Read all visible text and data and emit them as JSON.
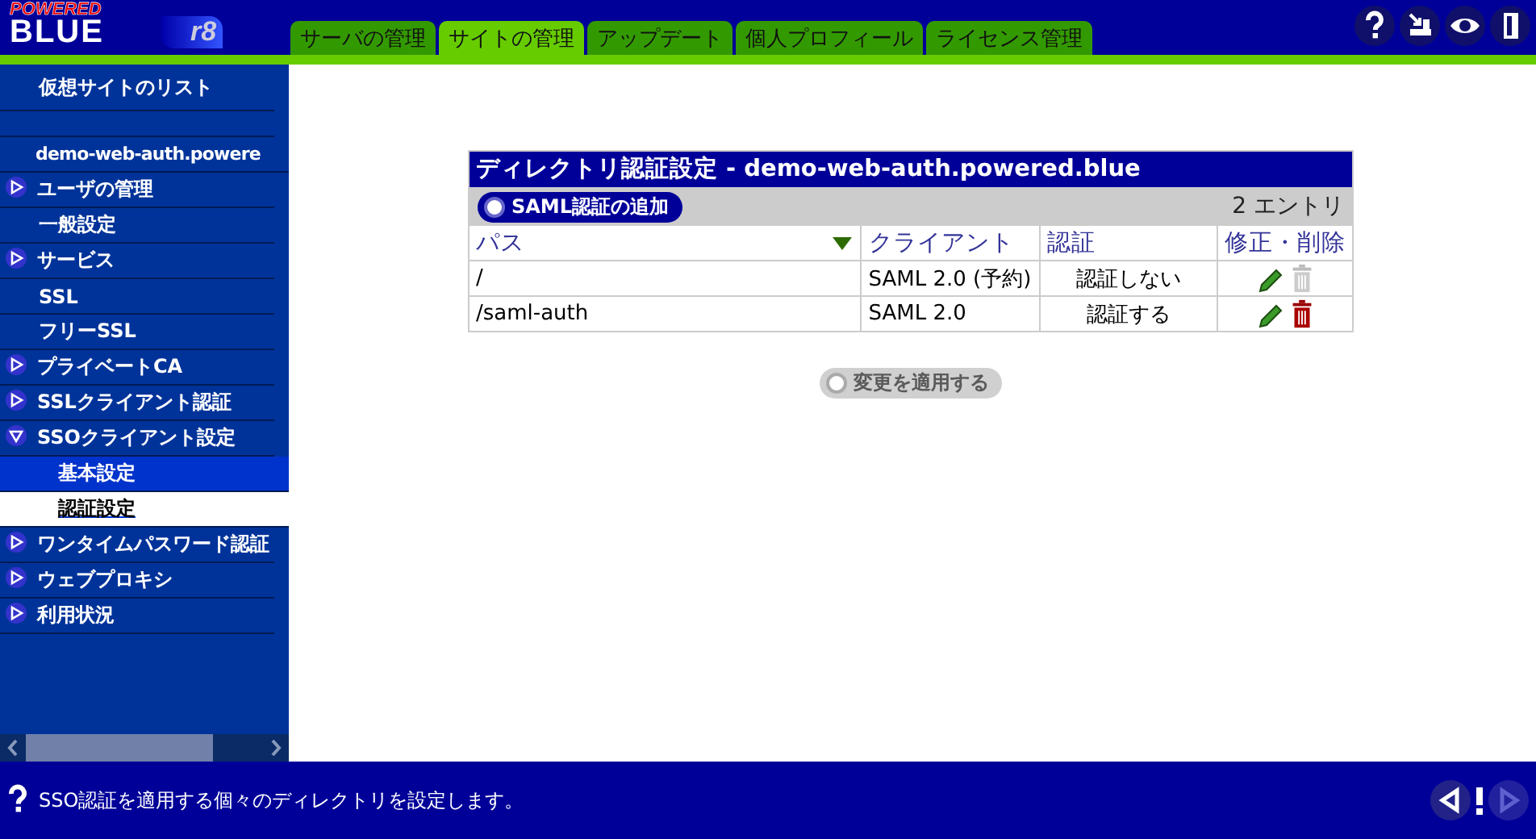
{
  "logo": {
    "top": "POWERED",
    "main": "BLUE",
    "version": "r8"
  },
  "tabs": [
    {
      "label": "サーバの管理",
      "selected": false
    },
    {
      "label": "サイトの管理",
      "selected": true
    },
    {
      "label": "アップデート",
      "selected": false
    },
    {
      "label": "個人プロフィール",
      "selected": false
    },
    {
      "label": "ライセンス管理",
      "selected": false
    }
  ],
  "sidebar": {
    "header": "仮想サイトのリスト",
    "site": "demo-web-auth.powere",
    "items": [
      {
        "kind": "group",
        "label": "ユーザの管理",
        "expanded": false
      },
      {
        "kind": "item",
        "label": "一般設定"
      },
      {
        "kind": "group",
        "label": "サービス",
        "expanded": false
      },
      {
        "kind": "item",
        "label": "SSL"
      },
      {
        "kind": "item",
        "label": "フリーSSL"
      },
      {
        "kind": "group",
        "label": "プライベートCA",
        "expanded": false
      },
      {
        "kind": "group",
        "label": "SSLクライアント認証",
        "expanded": false
      },
      {
        "kind": "group",
        "label": "SSOクライアント設定",
        "expanded": true,
        "children": [
          {
            "label": "基本設定",
            "selected": false
          },
          {
            "label": "認証設定",
            "selected": true
          }
        ]
      },
      {
        "kind": "group",
        "label": "ワンタイムパスワード認証",
        "expanded": false
      },
      {
        "kind": "group",
        "label": "ウェブプロキシ",
        "expanded": false
      },
      {
        "kind": "group",
        "label": "利用状況",
        "expanded": false
      }
    ]
  },
  "panel": {
    "title": "ディレクトリ認証設定 - demo-web-auth.powered.blue",
    "add_button": "SAML認証の追加",
    "count": "2 エントリ",
    "columns": [
      {
        "label": "パス",
        "sorted": true
      },
      {
        "label": "クライアント",
        "sorted": false
      },
      {
        "label": "認証",
        "sorted": false
      },
      {
        "label": "修正・削除",
        "sorted": false
      }
    ],
    "rows": [
      {
        "path": "/",
        "client": "SAML 2.0 (予約)",
        "auth": "認証しない",
        "deletable": false
      },
      {
        "path": "/saml-auth",
        "client": "SAML 2.0",
        "auth": "認証する",
        "deletable": true
      }
    ],
    "apply_button": {
      "label": "変更を適用する",
      "disabled": true
    }
  },
  "status_bar": {
    "text": "SSO認証を適用する個々のディレクトリを設定します。"
  }
}
